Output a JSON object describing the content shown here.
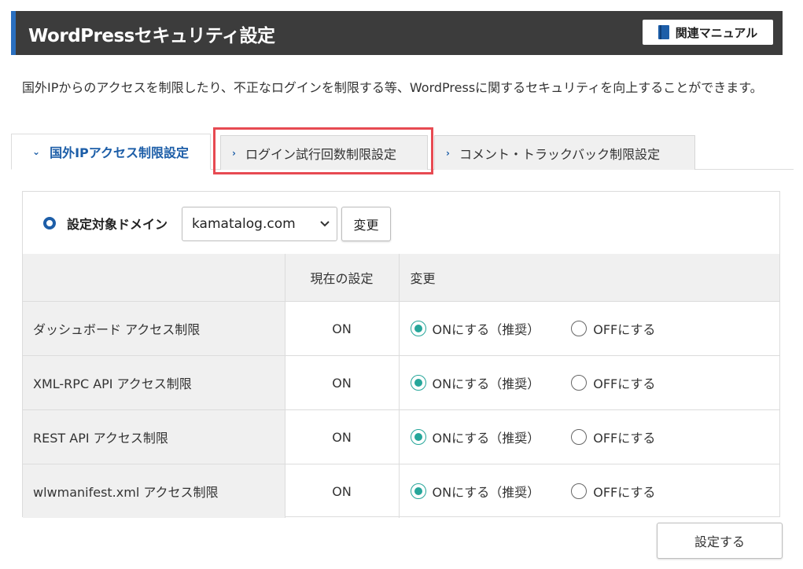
{
  "header": {
    "title": "WordPressセキュリティ設定",
    "manual_label": "関連マニュアル",
    "manual_icon": "book-icon",
    "accent": "#2a6fbf"
  },
  "description": "国外IPからのアクセスを制限したり、不正なログインを制限する等、WordPressに関するセキュリティを向上することができます。",
  "tabs": [
    {
      "label": "国外IPアクセス制限設定",
      "active": true
    },
    {
      "label": "ログイン試行回数制限設定",
      "active": false
    },
    {
      "label": "コメント・トラックバック制限設定",
      "active": false
    }
  ],
  "domain": {
    "label": "設定対象ドメイン",
    "selected": "kamatalog.com",
    "change_label": "変更"
  },
  "table": {
    "headers": [
      "",
      "現在の設定",
      "変更"
    ],
    "rows": [
      {
        "name": "ダッシュボード アクセス制限",
        "current": "ON",
        "on_label": "ONにする（推奨）",
        "off_label": "OFFにする",
        "selected": "on"
      },
      {
        "name": "XML-RPC API アクセス制限",
        "current": "ON",
        "on_label": "ONにする（推奨）",
        "off_label": "OFFにする",
        "selected": "on"
      },
      {
        "name": "REST API アクセス制限",
        "current": "ON",
        "on_label": "ONにする（推奨）",
        "off_label": "OFFにする",
        "selected": "on"
      },
      {
        "name": "wlwmanifest.xml アクセス制限",
        "current": "ON",
        "on_label": "ONにする（推奨）",
        "off_label": "OFFにする",
        "selected": "on"
      }
    ]
  },
  "submit_label": "設定する",
  "colors": {
    "highlight": "#e74a52",
    "radio_on": "#26a69a",
    "tab_active_text": "#1d5ea8"
  }
}
